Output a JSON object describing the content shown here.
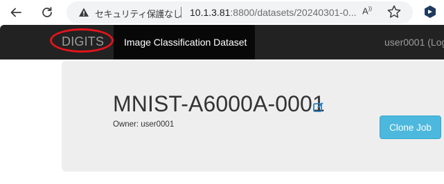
{
  "browser": {
    "security_label": "セキュリティ保護なし",
    "url_host": "10.1.3.81",
    "url_path": ":8800/datasets/20240301-0...",
    "read_aloud_label": "À"
  },
  "navbar": {
    "brand": "DIGITS",
    "active_item": "Image Classification Dataset",
    "user_text": "user0001 (Log"
  },
  "dataset": {
    "title": "MNIST-A6000A-0001",
    "owner": "Owner: user0001",
    "clone_button": "Clone Job"
  },
  "colors": {
    "navbar_bg": "#222222",
    "annotation_circle": "#e4141b",
    "button_bg": "#4cb8dd"
  }
}
